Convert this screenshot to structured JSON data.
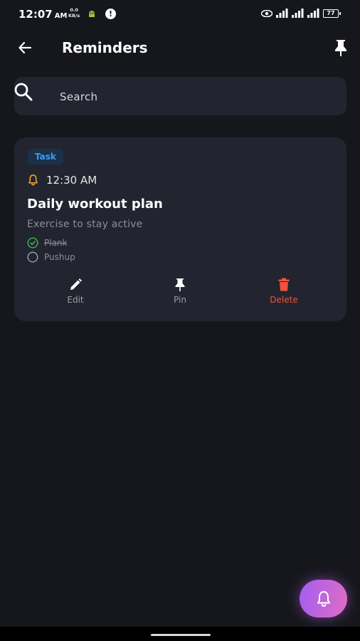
{
  "status_bar": {
    "time": "12:07",
    "ampm": "AM",
    "speed_value": "0.0",
    "speed_unit": "KB/s",
    "battery": "77"
  },
  "app_bar": {
    "title": "Reminders"
  },
  "search": {
    "placeholder": "Search",
    "value": ""
  },
  "reminder": {
    "tag": "Task",
    "time": "12:30 AM",
    "title": "Daily workout plan",
    "description": "Exercise to stay active",
    "checklist": [
      {
        "label": "Plank",
        "done": true
      },
      {
        "label": "Pushup",
        "done": false
      }
    ],
    "actions": {
      "edit": "Edit",
      "pin": "Pin",
      "delete": "Delete"
    }
  },
  "colors": {
    "background": "#16171c",
    "card": "#22252f",
    "tag_text": "#3d9cf0",
    "bell": "#f0a030",
    "delete": "#f0533e",
    "check_done": "#3fb950",
    "fab_start": "#a35ef0",
    "fab_end": "#e06dc6"
  },
  "icons": [
    "back-arrow-icon",
    "pin-icon",
    "search-icon",
    "bell-icon",
    "check-circle-icon",
    "empty-circle-icon",
    "pencil-icon",
    "trash-icon",
    "bell-add-icon",
    "android-icon",
    "alert-icon",
    "eye-icon",
    "signal-icon",
    "battery-icon"
  ]
}
